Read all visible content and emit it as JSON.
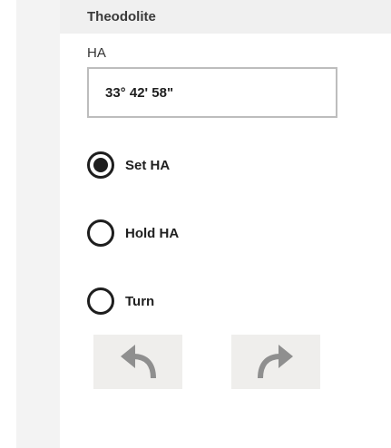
{
  "panel": {
    "title": "Theodolite"
  },
  "ha_field": {
    "label": "HA",
    "value": "33° 42' 58\""
  },
  "options": [
    {
      "label": "Set HA",
      "selected": true
    },
    {
      "label": "Hold HA",
      "selected": false
    },
    {
      "label": "Turn",
      "selected": false
    }
  ],
  "buttons": {
    "rotate_left_icon": "rotate-left-arrow",
    "rotate_right_icon": "rotate-right-arrow"
  },
  "colors": {
    "icon_gray": "#8f8f8f",
    "button_bg": "#efeeec"
  }
}
